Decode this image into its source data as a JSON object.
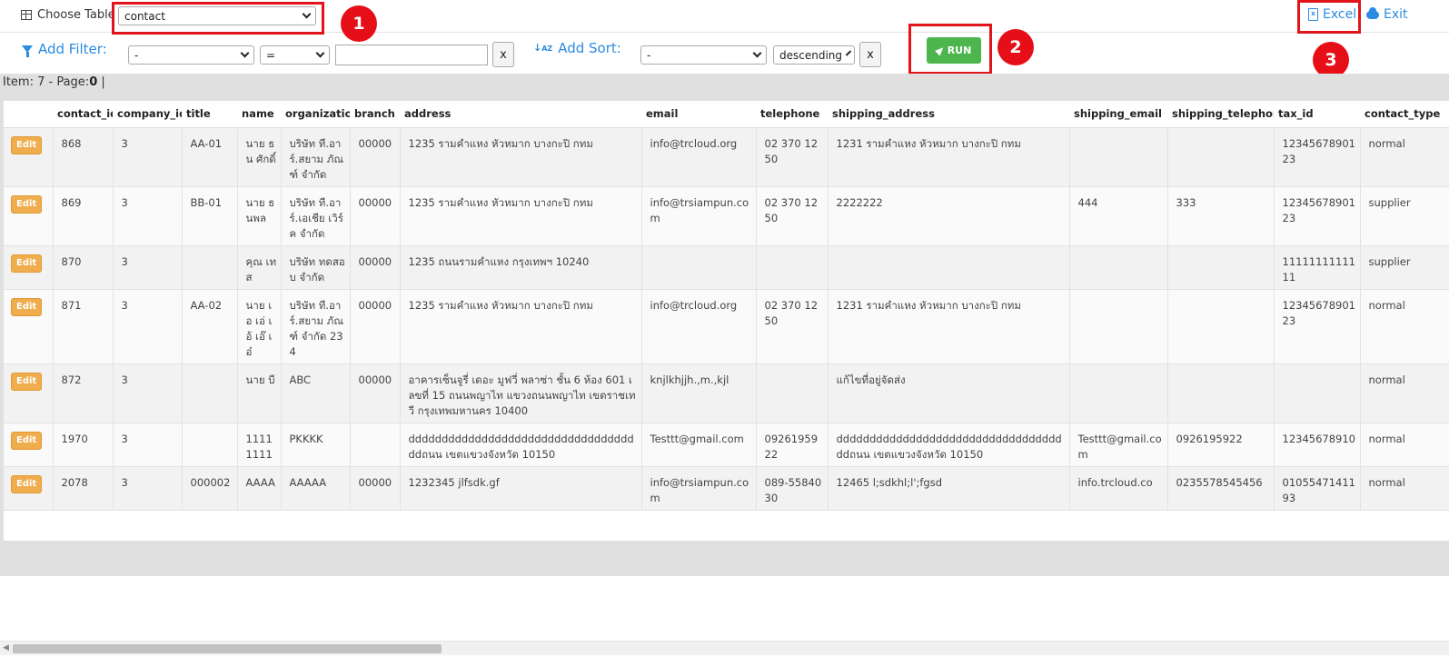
{
  "toolbar": {
    "choose_table_label": "Choose Table",
    "table_value": "contact",
    "excel_label": "Excel",
    "exit_label": "Exit"
  },
  "filter": {
    "add_filter_label": "Add Filter:",
    "field_value": "-",
    "operator_value": "=",
    "value": "",
    "clear_label": "x"
  },
  "sort": {
    "add_sort_label": "Add Sort:",
    "field_value": "-",
    "direction_value": "descending",
    "clear_label": "x"
  },
  "run_label": "RUN",
  "callouts": [
    "1",
    "2",
    "3"
  ],
  "status": {
    "prefix": "Item: 7 - Page:",
    "page": "0",
    "suffix": "|"
  },
  "table": {
    "columns": [
      "",
      "contact_id",
      "company_id",
      "title",
      "name",
      "organization",
      "branch",
      "address",
      "email",
      "telephone",
      "shipping_address",
      "shipping_email",
      "shipping_telephone",
      "tax_id",
      "contact_type"
    ],
    "edit_label": "Edit",
    "rows": [
      [
        "868",
        "3",
        "AA-01",
        "นาย ธน ศักดิ์",
        "บริษัท ที.อาร์.สยาม ภัณฑ์ จำกัด",
        "00000",
        "1235 รามคำแหง หัวหมาก บางกะปิ กทม",
        "info@trcloud.org",
        "02 370 1250",
        "1231 รามคำแหง หัวหมาก บางกะปิ กทม",
        "",
        "",
        "1234567890123",
        "normal"
      ],
      [
        "869",
        "3",
        "BB-01",
        "นาย ธนพล",
        "บริษัท ที.อาร์.เอเชีย เวิร์ค จำกัด",
        "00000",
        "1235 รามคำแหง หัวหมาก บางกะปิ กทม",
        "info@trsiampun.com",
        "02 370 1250",
        "2222222",
        "444",
        "333",
        "1234567890123",
        "supplier"
      ],
      [
        "870",
        "3",
        "",
        "คุณ เทส",
        "บริษัท ทดสอบ จำกัด",
        "00000",
        "1235 ถนนรามคำแหง กรุงเทพฯ 10240",
        "",
        "",
        "",
        "",
        "",
        "1111111111111",
        "supplier"
      ],
      [
        "871",
        "3",
        "AA-02",
        "นาย เอ เอ่ เอ้ เอ๊ เอ๋",
        "บริษัท ที.อาร์.สยาม ภัณฑ์ จำกัด 234",
        "00000",
        "1235 รามคำแหง หัวหมาก บางกะปิ กทม",
        "info@trcloud.org",
        "02 370 1250",
        "1231 รามคำแหง หัวหมาก บางกะปิ กทม",
        "",
        "",
        "1234567890123",
        "normal"
      ],
      [
        "872",
        "3",
        "",
        "นาย บี",
        "ABC",
        "00000",
        "อาคารเซ็นจูรี่ เดอะ มูฟวี่ พลาซ่า ชั้น 6 ห้อง 601 เลขที่ 15 ถนนพญาไท แขวงถนนพญาไท เขตราชเทวี กรุงเทพมหานคร 10400",
        "knjlkhjjh.,m.,kjl",
        "",
        "แก้ไขที่อยู่จัดส่ง",
        "",
        "",
        "",
        "normal"
      ],
      [
        "1970",
        "3",
        "",
        "11111111",
        "PKKKK",
        "",
        "ddddddddddddddddddddddddddddddddddddถนน เขตแขวงจังหวัด 10150",
        "Testtt@gmail.com",
        "0926195922",
        "ddddddddddddddddddddddddddddddddddddถนน เขตแขวงจังหวัด 10150",
        "Testtt@gmail.com",
        "0926195922",
        "12345678910",
        "normal"
      ],
      [
        "2078",
        "3",
        "000002",
        "AAAA",
        "AAAAA",
        "00000",
        "1232345 jlfsdk.gf",
        "info@trsiampun.com",
        "089-5584030",
        "12465 l;sdkhl;l';fgsd",
        "info.trcloud.co",
        "0235578545456",
        "0105547141193",
        "normal"
      ]
    ]
  }
}
